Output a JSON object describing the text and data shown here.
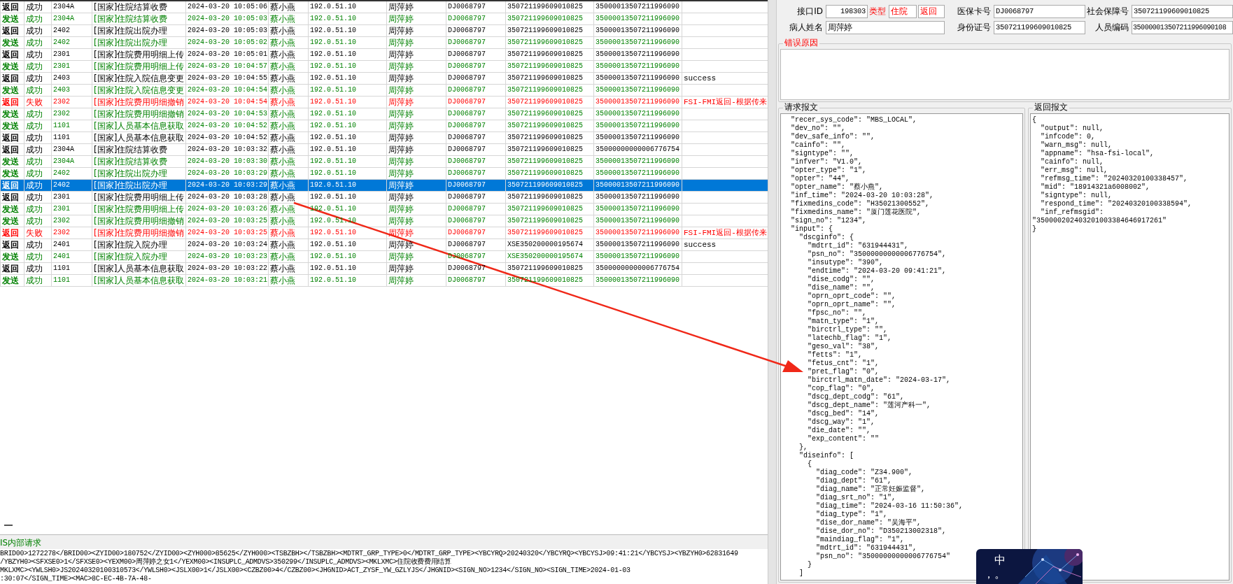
{
  "log_table": {
    "rows": [
      {
        "cells": [
          "返回",
          "成功",
          "2304A",
          "[国家]住院结算收费",
          "2024-03-20 10:05:06",
          "蔡小燕",
          "192.0.51.10",
          "周萍婷",
          "DJ0068797",
          "350721199609010825",
          "35000013507211996090",
          ""
        ],
        "kind": "return",
        "selected": false
      },
      {
        "cells": [
          "发送",
          "成功",
          "2304A",
          "[国家]住院结算收费",
          "2024-03-20 10:05:03",
          "蔡小燕",
          "192.0.51.10",
          "周萍婷",
          "DJ0068797",
          "350721199609010825",
          "35000013507211996090",
          ""
        ],
        "kind": "send",
        "selected": false
      },
      {
        "cells": [
          "返回",
          "成功",
          "2402",
          "[国家]住院出院办理",
          "2024-03-20 10:05:03",
          "蔡小燕",
          "192.0.51.10",
          "周萍婷",
          "DJ0068797",
          "350721199609010825",
          "35000013507211996090",
          ""
        ],
        "kind": "return",
        "selected": false
      },
      {
        "cells": [
          "发送",
          "成功",
          "2402",
          "[国家]住院出院办理",
          "2024-03-20 10:05:02",
          "蔡小燕",
          "192.0.51.10",
          "周萍婷",
          "DJ0068797",
          "350721199609010825",
          "35000013507211996090",
          ""
        ],
        "kind": "send",
        "selected": false
      },
      {
        "cells": [
          "返回",
          "成功",
          "2301",
          "[国家]住院费用明细上传",
          "2024-03-20 10:05:01",
          "蔡小燕",
          "192.0.51.10",
          "周萍婷",
          "DJ0068797",
          "350721199609010825",
          "35000013507211996090",
          ""
        ],
        "kind": "return",
        "selected": false
      },
      {
        "cells": [
          "发送",
          "成功",
          "2301",
          "[国家]住院费用明细上传",
          "2024-03-20 10:04:57",
          "蔡小燕",
          "192.0.51.10",
          "周萍婷",
          "DJ0068797",
          "350721199609010825",
          "35000013507211996090",
          ""
        ],
        "kind": "send",
        "selected": false
      },
      {
        "cells": [
          "返回",
          "成功",
          "2403",
          "[国家]住院入院信息变更",
          "2024-03-20 10:04:55",
          "蔡小燕",
          "192.0.51.10",
          "周萍婷",
          "DJ0068797",
          "350721199609010825",
          "35000013507211996090",
          "success"
        ],
        "kind": "return",
        "selected": false
      },
      {
        "cells": [
          "发送",
          "成功",
          "2403",
          "[国家]住院入院信息变更",
          "2024-03-20 10:04:54",
          "蔡小燕",
          "192.0.51.10",
          "周萍婷",
          "DJ0068797",
          "350721199609010825",
          "35000013507211996090",
          ""
        ],
        "kind": "send",
        "selected": false
      },
      {
        "cells": [
          "返回",
          "失败",
          "2302",
          "[国家]住院费用明细撤销",
          "2024-03-20 10:04:54",
          "蔡小燕",
          "192.0.51.10",
          "周萍婷",
          "DJ0068797",
          "350721199609010825",
          "35000013507211996090",
          "FSI-FMI返回-根据传来"
        ],
        "kind": "fail",
        "selected": false
      },
      {
        "cells": [
          "发送",
          "成功",
          "2302",
          "[国家]住院费用明细撤销",
          "2024-03-20 10:04:53",
          "蔡小燕",
          "192.0.51.10",
          "周萍婷",
          "DJ0068797",
          "350721199609010825",
          "35000013507211996090",
          ""
        ],
        "kind": "send",
        "selected": false
      },
      {
        "cells": [
          "发送",
          "成功",
          "1101",
          "[国家]人员基本信息获取",
          "2024-03-20 10:04:52",
          "蔡小燕",
          "192.0.51.10",
          "周萍婷",
          "DJ0068797",
          "350721199609010825",
          "35000013507211996090",
          ""
        ],
        "kind": "send",
        "selected": false
      },
      {
        "cells": [
          "返回",
          "成功",
          "1101",
          "[国家]人员基本信息获取",
          "2024-03-20 10:04:52",
          "蔡小燕",
          "192.0.51.10",
          "周萍婷",
          "DJ0068797",
          "350721199609010825",
          "35000013507211996090",
          ""
        ],
        "kind": "return",
        "selected": false
      },
      {
        "cells": [
          "返回",
          "成功",
          "2304A",
          "[国家]住院结算收费",
          "2024-03-20 10:03:32",
          "蔡小燕",
          "192.0.51.10",
          "周萍婷",
          "DJ0068797",
          "350721199609010825",
          "35000000000006776754",
          ""
        ],
        "kind": "return",
        "selected": false
      },
      {
        "cells": [
          "发送",
          "成功",
          "2304A",
          "[国家]住院结算收费",
          "2024-03-20 10:03:30",
          "蔡小燕",
          "192.0.51.10",
          "周萍婷",
          "DJ0068797",
          "350721199609010825",
          "35000013507211996090",
          ""
        ],
        "kind": "send",
        "selected": false
      },
      {
        "cells": [
          "发送",
          "成功",
          "2402",
          "[国家]住院出院办理",
          "2024-03-20 10:03:29",
          "蔡小燕",
          "192.0.51.10",
          "周萍婷",
          "DJ0068797",
          "350721199609010825",
          "35000013507211996090",
          ""
        ],
        "kind": "send",
        "selected": false
      },
      {
        "cells": [
          "返回",
          "成功",
          "2402",
          "[国家]住院出院办理",
          "2024-03-20 10:03:29",
          "蔡小燕",
          "192.0.51.10",
          "周萍婷",
          "DJ0068797",
          "350721199609010825",
          "35000013507211996090",
          ""
        ],
        "kind": "return",
        "selected": true
      },
      {
        "cells": [
          "返回",
          "成功",
          "2301",
          "[国家]住院费用明细上传",
          "2024-03-20 10:03:28",
          "蔡小燕",
          "192.0.51.10",
          "周萍婷",
          "DJ0068797",
          "350721199609010825",
          "35000013507211996090",
          ""
        ],
        "kind": "return",
        "selected": false
      },
      {
        "cells": [
          "发送",
          "成功",
          "2301",
          "[国家]住院费用明细上传",
          "2024-03-20 10:03:26",
          "蔡小燕",
          "192.0.51.10",
          "周萍婷",
          "DJ0068797",
          "350721199609010825",
          "35000013507211996090",
          ""
        ],
        "kind": "send",
        "selected": false
      },
      {
        "cells": [
          "发送",
          "成功",
          "2302",
          "[国家]住院费用明细撤销",
          "2024-03-20 10:03:25",
          "蔡小燕",
          "192.0.51.10",
          "周萍婷",
          "DJ0068797",
          "350721199609010825",
          "35000013507211996090",
          ""
        ],
        "kind": "send",
        "selected": false
      },
      {
        "cells": [
          "返回",
          "失败",
          "2302",
          "[国家]住院费用明细撤销",
          "2024-03-20 10:03:25",
          "蔡小燕",
          "192.0.51.10",
          "周萍婷",
          "DJ0068797",
          "350721199609010825",
          "35000013507211996090",
          "FSI-FMI返回-根据传来"
        ],
        "kind": "fail",
        "selected": false
      },
      {
        "cells": [
          "返回",
          "成功",
          "2401",
          "[国家]住院入院办理",
          "2024-03-20 10:03:24",
          "蔡小燕",
          "192.0.51.10",
          "周萍婷",
          "DJ0068797",
          "XSE350200000195674",
          "35000013507211996090",
          "success"
        ],
        "kind": "return",
        "selected": false
      },
      {
        "cells": [
          "发送",
          "成功",
          "2401",
          "[国家]住院入院办理",
          "2024-03-20 10:03:23",
          "蔡小燕",
          "192.0.51.10",
          "周萍婷",
          "DJ0068797",
          "XSE350200000195674",
          "35000013507211996090",
          ""
        ],
        "kind": "send",
        "selected": false
      },
      {
        "cells": [
          "返回",
          "成功",
          "1101",
          "[国家]人员基本信息获取",
          "2024-03-20 10:03:22",
          "蔡小燕",
          "192.0.51.10",
          "周萍婷",
          "DJ0068797",
          "350721199609010825",
          "35000000000006776754",
          ""
        ],
        "kind": "return",
        "selected": false
      },
      {
        "cells": [
          "发送",
          "成功",
          "1101",
          "[国家]人员基本信息获取",
          "2024-03-20 10:03:21",
          "蔡小燕",
          "192.0.51.10",
          "周萍婷",
          "DJ0068797",
          "350721199609010825",
          "35000013507211996090",
          ""
        ],
        "kind": "send",
        "selected": false
      }
    ]
  },
  "internal_request": {
    "title": "IS内部请求",
    "lines": [
      "BRID00>1272278</BRID00><ZYID00>180752</ZYID00><ZYH000>85625</ZYH000><TSBZBH></TSBZBH><MDTRT_GRP_TYPE>0</MDTRT_GRP_TYPE><YBCYRQ>20240320</YBCYRQ><YBCYSJ>09:41:21</YBCYSJ><YBZYH0>62831649",
      "/YBZYH0><SFXSE0>1</SFXSE0><YEXM00>周萍婷之女1</YEXM00><INSUPLC_ADMDVS>350299</INSUPLC_ADMDVS><MKLXMC>住院收费费用结算",
      "MKLXMC><YWLSH0>JS20240320100310573</YWLSH0><JSLX00>1</JSLX00><CZBZ00>4</CZBZ00><JHGNID>ACT_ZYSF_YW_GZLYJS</JHGNID><SIGN_NO>1234</SIGN_NO><SIGN_TIME>2024-01-03",
      ":30:07</SIGN_TIME><MAC>8C-EC-4B-7A-48-"
    ]
  },
  "patient_form": {
    "interface_id": {
      "label": "接口ID",
      "value": "198303"
    },
    "type": {
      "label": "类型",
      "values": [
        "住院",
        "返回"
      ]
    },
    "card_no": {
      "label": "医保卡号",
      "value": "DJ0068797"
    },
    "social_security_no": {
      "label": "社会保障号",
      "value": "350721199609010825"
    },
    "patient_name": {
      "label": "病人姓名",
      "value": "周萍婷"
    },
    "id_no": {
      "label": "身份证号",
      "value": "350721199609010825"
    },
    "person_code": {
      "label": "人员编码",
      "value": "350000013507211996090108"
    }
  },
  "error_reason": {
    "title": "错误原因"
  },
  "request_message": {
    "title": "请求报文",
    "text": "  \"recer_sys_code\": \"MBS_LOCAL\",\n  \"dev_no\": \"\",\n  \"dev_safe_info\": \"\",\n  \"cainfo\": \"\",\n  \"signtype\": \"\",\n  \"infver\": \"V1.0\",\n  \"opter_type\": \"1\",\n  \"opter\": \"44\",\n  \"opter_name\": \"蔡小燕\",\n  \"inf_time\": \"2024-03-20 10:03:28\",\n  \"fixmedins_code\": \"H35021300552\",\n  \"fixmedins_name\": \"厦门莲花医院\",\n  \"sign_no\": \"1234\",\n  \"input\": {\n    \"dscginfo\": {\n      \"mdtrt_id\": \"631944431\",\n      \"psn_no\": \"35000000000006776754\",\n      \"insutype\": \"390\",\n      \"endtime\": \"2024-03-20 09:41:21\",\n      \"dise_codg\": \"\",\n      \"dise_name\": \"\",\n      \"oprn_oprt_code\": \"\",\n      \"oprn_oprt_name\": \"\",\n      \"fpsc_no\": \"\",\n      \"matn_type\": \"1\",\n      \"birctrl_type\": \"\",\n      \"latechb_flag\": \"1\",\n      \"geso_val\": \"38\",\n      \"fetts\": \"1\",\n      \"fetus_cnt\": \"1\",\n      \"pret_flag\": \"0\",\n      \"birctrl_matn_date\": \"2024-03-17\",\n      \"cop_flag\": \"0\",\n      \"dscg_dept_codg\": \"61\",\n      \"dscg_dept_name\": \"莲河产科一\",\n      \"dscg_bed\": \"14\",\n      \"dscg_way\": \"1\",\n      \"die_date\": \"\",\n      \"exp_content\": \"\"\n    },\n    \"diseinfo\": [\n      {\n        \"diag_code\": \"Z34.900\",\n        \"diag_dept\": \"61\",\n        \"diag_name\": \"正常妊娠监督\",\n        \"diag_srt_no\": \"1\",\n        \"diag_time\": \"2024-03-16 11:50:36\",\n        \"diag_type\": \"1\",\n        \"dise_dor_name\": \"吴海平\",\n        \"dise_dor_no\": \"D350213002318\",\n        \"maindiag_flag\": \"1\",\n        \"mdtrt_id\": \"631944431\",\n        \"psn_no\": \"35000000000006776754\"\n      }\n    ]"
  },
  "response_message": {
    "title": "返回报文",
    "text": "{\n  \"output\": null,\n  \"infcode\": 0,\n  \"warn_msg\": null,\n  \"appname\": \"hsa-fsi-local\",\n  \"cainfo\": null,\n  \"err_msg\": null,\n  \"refmsg_time\": \"20240320100338457\",\n  \"mid\": \"18914321a6008002\",\n  \"signtype\": null,\n  \"respond_time\": \"20240320100338594\",\n  \"inf_refmsgid\":\n\"350000202403201003384646917261\"\n}"
  },
  "ime_popup": {
    "kind": "picture",
    "labels": [
      "中",
      "，。"
    ]
  }
}
